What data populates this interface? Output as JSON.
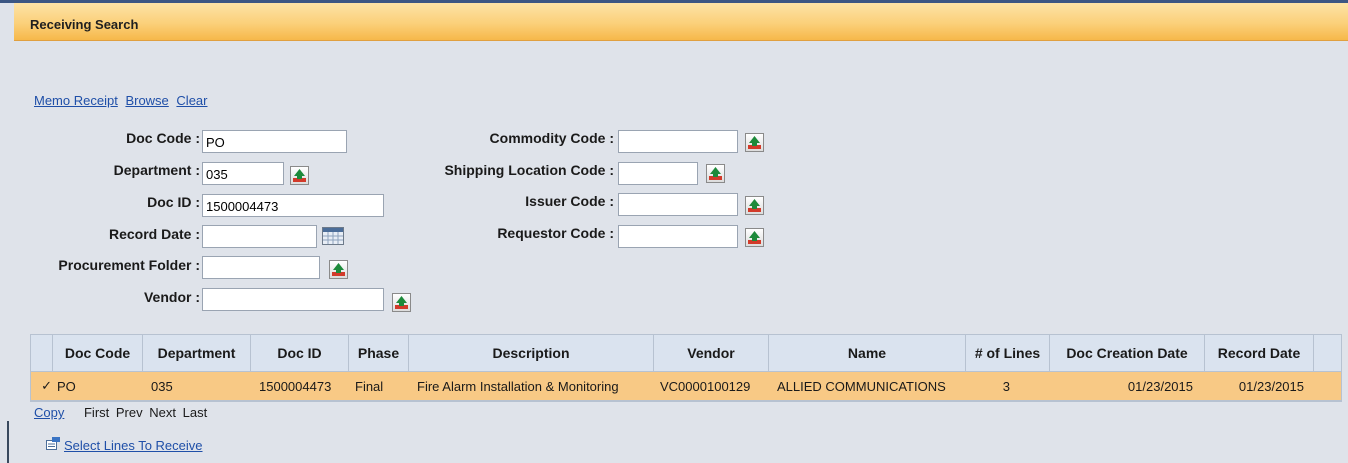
{
  "header": {
    "title": "Receiving Search"
  },
  "links": [
    "Memo Receipt",
    "Browse",
    "Clear"
  ],
  "form": {
    "doc_code": {
      "label": "Doc Code :",
      "value": "PO"
    },
    "department": {
      "label": "Department :",
      "value": "035"
    },
    "doc_id": {
      "label": "Doc ID :",
      "value": "1500004473"
    },
    "record_date": {
      "label": "Record Date :",
      "value": ""
    },
    "procurement_folder": {
      "label": "Procurement Folder :",
      "value": ""
    },
    "vendor": {
      "label": "Vendor :",
      "value": ""
    },
    "commodity_code": {
      "label": "Commodity Code :",
      "value": ""
    },
    "shipping_location_code": {
      "label": "Shipping Location Code :",
      "value": ""
    },
    "issuer_code": {
      "label": "Issuer Code :",
      "value": ""
    },
    "requestor_code": {
      "label": "Requestor Code :",
      "value": ""
    }
  },
  "grid": {
    "columns": [
      "Doc Code",
      "Department",
      "Doc ID",
      "Phase",
      "Description",
      "Vendor",
      "Name",
      "# of Lines",
      "Doc Creation Date",
      "Record Date"
    ],
    "rows": [
      {
        "check": "✓",
        "doc_code": "PO",
        "department": "035",
        "doc_id": "1500004473",
        "phase": "Final",
        "description": "Fire Alarm Installation & Monitoring",
        "vendor": "VC0000100129",
        "name": "ALLIED COMMUNICATIONS",
        "lines": "3",
        "doc_creation_date": "01/23/2015",
        "record_date": "01/23/2015"
      }
    ]
  },
  "pager": {
    "copy": "Copy",
    "first": "First",
    "prev": "Prev",
    "next": "Next",
    "last": "Last"
  },
  "action": {
    "select_lines": "Select Lines To Receive",
    "icon": "select-lines-icon"
  },
  "colors": {
    "header_orange": "#f6b84a",
    "row_selected": "#f8c985",
    "link": "#1f4fa8",
    "background": "#dfe3ea"
  }
}
